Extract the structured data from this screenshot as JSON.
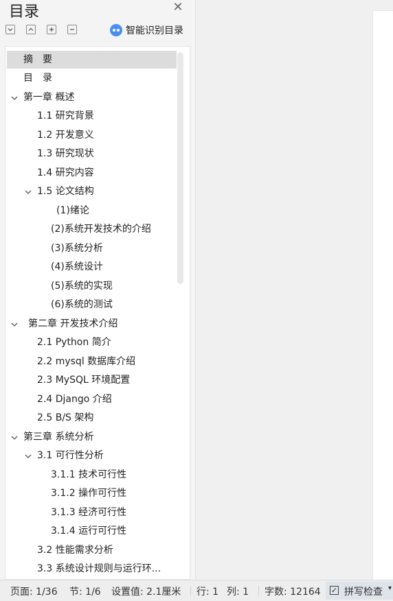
{
  "pane": {
    "title": "目录",
    "smart_toc": "智能识别目录"
  },
  "toc": [
    "摘　要",
    "目　录",
    "第一章 概述",
    "1.1 研究背景",
    "1.2  开发意义",
    "1.3  研究现状",
    "1.4  研究内容",
    "1.5  论文结构",
    "(1)绪论",
    "(2)系统开发技术的介绍",
    "(3)系统分析",
    "(4)系统设计",
    "(5)系统的实现",
    "(6)系统的测试",
    "第二章 开发技术介绍",
    "2.1    Python 简介",
    "2.2    mysql 数据库介绍",
    "2.3    MySQL 环境配置",
    "2.4    Django 介绍",
    "2.5    B/S 架构",
    "第三章 系统分析",
    "3.1  可行性分析",
    "3.1.1 技术可行性",
    "3.1.2 操作可行性",
    "3.1.3  经济可行性",
    "3.1.4  运行可行性",
    "3.2 性能需求分析",
    "3.3 系统设计规则与运行环..."
  ],
  "status": {
    "page": "页面: 1/36",
    "section": "节: 1/6",
    "setting": "设置值: 2.1厘米",
    "row": "行: 1",
    "col": "列: 1",
    "words": "字数: 12164",
    "spell": "拼写检查"
  },
  "icons": {
    "close": "close-icon",
    "collapse_all": "collapse-all-icon",
    "expand_up": "chevron-up-icon",
    "expand_add": "plus-icon",
    "collapse_remove": "minus-icon",
    "smart": "ai-assistant-icon",
    "spell": "checkbox-icon"
  }
}
